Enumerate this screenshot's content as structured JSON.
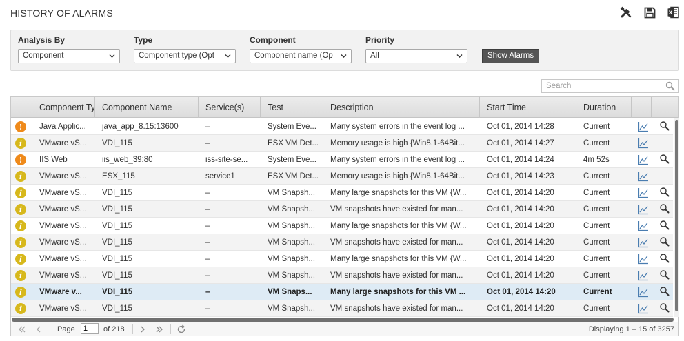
{
  "window": {
    "title": "HISTORY OF ALARMS"
  },
  "toolbar": {
    "tools_icon": "tools-icon",
    "save_icon": "save-icon",
    "excel_icon": "excel-icon"
  },
  "filters": {
    "analysis_by": {
      "label": "Analysis By",
      "value": "Component"
    },
    "type": {
      "label": "Type",
      "value": "Component type (Opt"
    },
    "component": {
      "label": "Component",
      "value": "Component name (Op"
    },
    "priority": {
      "label": "Priority",
      "value": "All"
    },
    "show_button": "Show Alarms"
  },
  "search": {
    "placeholder": "Search"
  },
  "table": {
    "columns": [
      "Component Type",
      "Component Name",
      "Service(s)",
      "Test",
      "Description",
      "Start Time",
      "Duration"
    ],
    "rows": [
      {
        "sev": "major",
        "type": "Java Applic...",
        "name": "java_app_8.15:13600",
        "service": "–",
        "test": "System Eve...",
        "desc": "Many system errors in the event log ...",
        "start": "Oct 01, 2014 14:28",
        "duration": "Current",
        "search": true
      },
      {
        "sev": "minor",
        "type": "VMware vS...",
        "name": "VDI_115",
        "service": "–",
        "test": "ESX VM Det...",
        "desc": "Memory usage is high {Win8.1-64Bit...",
        "start": "Oct 01, 2014 14:27",
        "duration": "Current",
        "search": false
      },
      {
        "sev": "major",
        "type": "IIS Web",
        "name": "iis_web_39:80",
        "service": "iss-site-se...",
        "test": "System Eve...",
        "desc": "Many system errors in the event log ...",
        "start": "Oct 01, 2014 14:24",
        "duration": "4m 52s",
        "search": true
      },
      {
        "sev": "minor",
        "type": "VMware vS...",
        "name": "ESX_115",
        "service": "service1",
        "test": "ESX VM Det...",
        "desc": "Memory usage is high {Win8.1-64Bit...",
        "start": "Oct 01, 2014 14:23",
        "duration": "Current",
        "search": false
      },
      {
        "sev": "minor",
        "type": "VMware vS...",
        "name": "VDI_115",
        "service": "–",
        "test": "VM Snapsh...",
        "desc": "Many large snapshots for this VM {W...",
        "start": "Oct 01, 2014 14:20",
        "duration": "Current",
        "search": true
      },
      {
        "sev": "minor",
        "type": "VMware vS...",
        "name": "VDI_115",
        "service": "–",
        "test": "VM Snapsh...",
        "desc": "VM snapshots have existed for man...",
        "start": "Oct 01, 2014 14:20",
        "duration": "Current",
        "search": true
      },
      {
        "sev": "minor",
        "type": "VMware vS...",
        "name": "VDI_115",
        "service": "–",
        "test": "VM Snapsh...",
        "desc": "Many large snapshots for this VM {W...",
        "start": "Oct 01, 2014 14:20",
        "duration": "Current",
        "search": true
      },
      {
        "sev": "minor",
        "type": "VMware vS...",
        "name": "VDI_115",
        "service": "–",
        "test": "VM Snapsh...",
        "desc": "VM snapshots have existed for man...",
        "start": "Oct 01, 2014 14:20",
        "duration": "Current",
        "search": true
      },
      {
        "sev": "minor",
        "type": "VMware vS...",
        "name": "VDI_115",
        "service": "–",
        "test": "VM Snapsh...",
        "desc": "Many large snapshots for this VM {W...",
        "start": "Oct 01, 2014 14:20",
        "duration": "Current",
        "search": true
      },
      {
        "sev": "minor",
        "type": "VMware vS...",
        "name": "VDI_115",
        "service": "–",
        "test": "VM Snapsh...",
        "desc": "VM snapshots have existed for man...",
        "start": "Oct 01, 2014 14:20",
        "duration": "Current",
        "search": true
      },
      {
        "sev": "minor",
        "type": "VMware v...",
        "name": "VDI_115",
        "service": "–",
        "test": "VM Snaps...",
        "desc": "Many large snapshots for this VM ...",
        "start": "Oct 01, 2014 14:20",
        "duration": "Current",
        "search": true,
        "selected": true
      },
      {
        "sev": "minor",
        "type": "VMware vS...",
        "name": "VDI_115",
        "service": "–",
        "test": "VM Snapsh...",
        "desc": "VM snapshots have existed for man...",
        "start": "Oct 01, 2014 14:20",
        "duration": "Current",
        "search": true
      }
    ]
  },
  "pager": {
    "page_label": "Page",
    "page_value": "1",
    "of_label": "of 218",
    "display": "Displaying 1 – 15 of 3257"
  },
  "colors": {
    "major": "#ef8a1b",
    "minor": "#d7b81c",
    "selected_row": "#deebf5",
    "button": "#555555"
  }
}
